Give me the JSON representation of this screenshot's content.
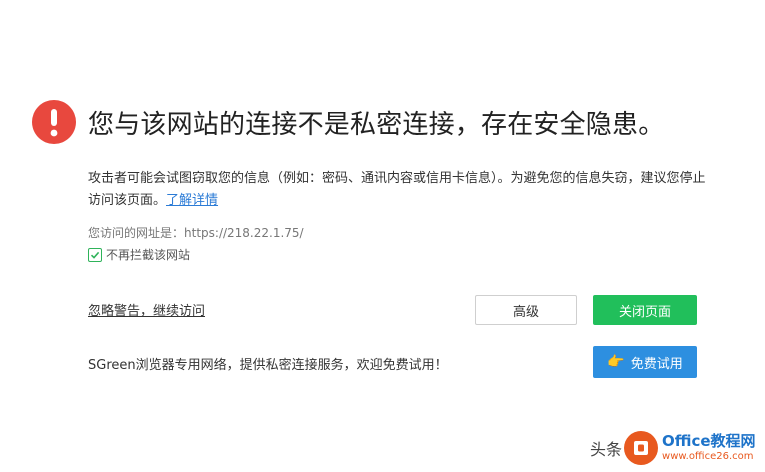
{
  "warning": {
    "title": "您与该网站的连接不是私密连接，存在安全隐患。",
    "description": "攻击者可能会试图窃取您的信息（例如：密码、通讯内容或信用卡信息）。为避免您的信息失窃，建议您停止访问该页面。",
    "learn_more": "了解详情",
    "url_label": "您访问的网址是：",
    "url_value": "https://218.22.1.75/",
    "checkbox_label": "不再拦截该网站",
    "checkbox_checked": true
  },
  "actions": {
    "ignore_link": "忽略警告，继续访问",
    "advanced_button": "高级",
    "close_button": "关闭页面"
  },
  "promo": {
    "text": "SGreen浏览器专用网络，提供私密连接服务，欢迎免费试用！",
    "trial_button": "免费试用"
  },
  "watermark": {
    "prefix": "头条",
    "brand": "Office教程网",
    "site": "www.office26.com"
  },
  "colors": {
    "warning_red": "#e8483e",
    "close_green": "#21bf5b",
    "trial_blue": "#2d8fe0",
    "link_blue": "#2b7bd6"
  }
}
